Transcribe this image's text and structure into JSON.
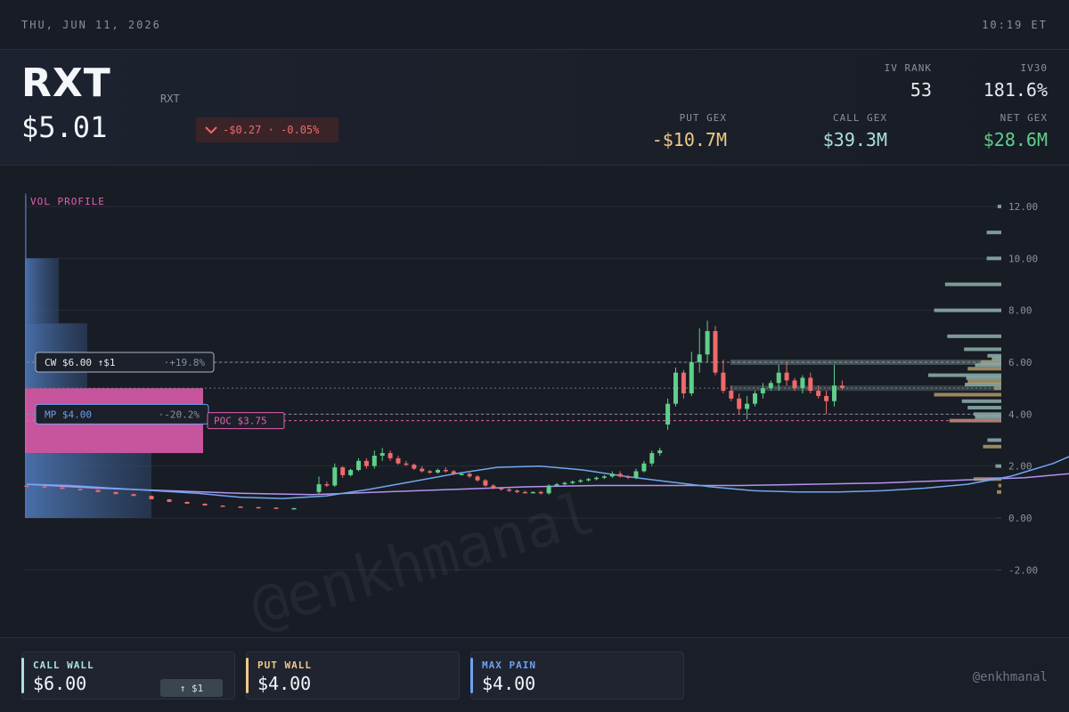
{
  "topbar": {
    "date": "THU, JUN 11, 2026",
    "time": "10:19 ET"
  },
  "quote": {
    "ticker": "RXT",
    "ticker_sub": "RXT",
    "price": "$5.01",
    "change": "-$0.27 · -0.05%"
  },
  "stats": {
    "iv_rank_label": "IV RANK",
    "iv_rank": "53",
    "iv30_label": "IV30",
    "iv30": "181.6%",
    "put_gex_label": "PUT GEX",
    "put_gex": "-$10.7M",
    "call_gex_label": "CALL GEX",
    "call_gex": "$39.3M",
    "net_gex_label": "NET GEX",
    "net_gex": "$28.6M"
  },
  "colors": {
    "up": "#5fcf8a",
    "down": "#ef6a6a",
    "put": "#f0c987",
    "call": "#a9e2dc",
    "net": "#5fcf8a",
    "maxpain": "#6fa0f0",
    "poc": "#e65fb3"
  },
  "chart_data": {
    "type": "candlestick",
    "ylim": [
      -2,
      12
    ],
    "yticks": [
      "12.00",
      "10.00",
      "8.00",
      "6.00",
      "4.00",
      "2.00",
      "0.00",
      "-2.00"
    ],
    "ytick_values": [
      12,
      10,
      8,
      6,
      4,
      2,
      0,
      -2
    ],
    "vol_profile_label": "VOL PROFILE",
    "vol_profile": [
      {
        "lo": 0,
        "hi": 2.5,
        "v": 0.71
      },
      {
        "lo": 2.5,
        "hi": 5,
        "v": 1.0,
        "poc": true
      },
      {
        "lo": 5,
        "hi": 7.5,
        "v": 0.35
      },
      {
        "lo": 7.5,
        "hi": 10,
        "v": 0.19
      },
      {
        "lo": 10,
        "hi": 12.5,
        "v": 0.01
      }
    ],
    "levels": {
      "call_wall": {
        "price": 6.0,
        "label": "CW $6.00 ↑$1",
        "pct": "·+19.8%"
      },
      "current": {
        "price": 5.0
      },
      "max_pain": {
        "price": 4.0,
        "label": "MP $4.00",
        "pct": "·-20.2%"
      },
      "poc": {
        "price": 3.75,
        "label": "POC $3.75"
      }
    },
    "ohlc": [
      [
        1.25,
        1.25,
        1.22,
        1.22
      ],
      [
        1.22,
        1.22,
        1.18,
        1.18
      ],
      [
        1.18,
        1.19,
        1.12,
        1.12
      ],
      [
        1.12,
        1.13,
        1.08,
        1.08
      ],
      [
        1.08,
        1.09,
        1.0,
        1.0
      ],
      [
        1.0,
        1.01,
        0.92,
        0.92
      ],
      [
        0.92,
        0.93,
        0.85,
        0.85
      ],
      [
        0.85,
        0.86,
        0.72,
        0.72
      ],
      [
        0.72,
        0.73,
        0.62,
        0.62
      ],
      [
        0.62,
        0.63,
        0.55,
        0.55
      ],
      [
        0.55,
        0.56,
        0.48,
        0.48
      ],
      [
        0.48,
        0.49,
        0.44,
        0.44
      ],
      [
        0.44,
        0.45,
        0.42,
        0.42
      ],
      [
        0.42,
        0.43,
        0.4,
        0.4
      ],
      [
        0.4,
        0.41,
        0.39,
        0.39
      ],
      [
        0.38,
        0.39,
        0.38,
        0.38
      ],
      [
        1.0,
        1.6,
        0.9,
        1.3
      ],
      [
        1.3,
        1.4,
        1.2,
        1.25
      ],
      [
        1.25,
        2.1,
        1.2,
        1.95
      ],
      [
        1.95,
        2.0,
        1.55,
        1.65
      ],
      [
        1.65,
        1.9,
        1.6,
        1.85
      ],
      [
        1.85,
        2.3,
        1.8,
        2.2
      ],
      [
        2.2,
        2.3,
        1.9,
        2.0
      ],
      [
        2.0,
        2.6,
        1.9,
        2.4
      ],
      [
        2.4,
        2.7,
        2.2,
        2.5
      ],
      [
        2.5,
        2.6,
        2.2,
        2.3
      ],
      [
        2.3,
        2.4,
        2.05,
        2.1
      ],
      [
        2.1,
        2.2,
        2.0,
        2.05
      ],
      [
        2.05,
        2.1,
        1.85,
        1.9
      ],
      [
        1.9,
        2.0,
        1.75,
        1.8
      ],
      [
        1.8,
        1.85,
        1.7,
        1.75
      ],
      [
        1.75,
        1.9,
        1.7,
        1.85
      ],
      [
        1.85,
        1.95,
        1.75,
        1.8
      ],
      [
        1.8,
        1.85,
        1.65,
        1.7
      ],
      [
        1.7,
        1.75,
        1.65,
        1.7
      ],
      [
        1.7,
        1.75,
        1.55,
        1.6
      ],
      [
        1.6,
        1.65,
        1.4,
        1.45
      ],
      [
        1.45,
        1.5,
        1.2,
        1.25
      ],
      [
        1.25,
        1.3,
        1.1,
        1.15
      ],
      [
        1.15,
        1.2,
        1.05,
        1.1
      ],
      [
        1.1,
        1.15,
        1.0,
        1.05
      ],
      [
        1.05,
        1.1,
        0.95,
        1.0
      ],
      [
        1.0,
        1.05,
        0.95,
        0.98
      ],
      [
        0.98,
        1.02,
        0.95,
        1.0
      ],
      [
        1.0,
        1.05,
        0.9,
        0.95
      ],
      [
        0.95,
        1.3,
        0.9,
        1.25
      ],
      [
        1.25,
        1.35,
        1.2,
        1.3
      ],
      [
        1.3,
        1.4,
        1.25,
        1.35
      ],
      [
        1.35,
        1.45,
        1.3,
        1.4
      ],
      [
        1.4,
        1.5,
        1.35,
        1.45
      ],
      [
        1.45,
        1.55,
        1.4,
        1.5
      ],
      [
        1.5,
        1.6,
        1.45,
        1.55
      ],
      [
        1.55,
        1.65,
        1.5,
        1.6
      ],
      [
        1.6,
        1.8,
        1.55,
        1.7
      ],
      [
        1.7,
        1.8,
        1.55,
        1.6
      ],
      [
        1.6,
        1.65,
        1.5,
        1.55
      ],
      [
        1.55,
        1.9,
        1.5,
        1.8
      ],
      [
        1.8,
        2.2,
        1.75,
        2.1
      ],
      [
        2.1,
        2.6,
        2.0,
        2.5
      ],
      [
        2.5,
        2.7,
        2.4,
        2.6
      ],
      [
        3.6,
        4.6,
        3.4,
        4.4
      ],
      [
        4.4,
        5.8,
        4.3,
        5.6
      ],
      [
        5.6,
        5.7,
        4.6,
        4.8
      ],
      [
        4.8,
        6.4,
        4.7,
        6.0
      ],
      [
        6.0,
        7.3,
        5.6,
        6.3
      ],
      [
        6.3,
        7.6,
        6.0,
        7.2
      ],
      [
        7.2,
        7.4,
        5.5,
        5.6
      ],
      [
        5.6,
        6.1,
        4.8,
        4.9
      ],
      [
        4.9,
        5.1,
        4.5,
        4.6
      ],
      [
        4.6,
        4.8,
        4.0,
        4.2
      ],
      [
        4.2,
        4.7,
        3.8,
        4.4
      ],
      [
        4.4,
        4.9,
        4.3,
        4.8
      ],
      [
        4.8,
        5.2,
        4.6,
        5.0
      ],
      [
        5.0,
        5.3,
        4.9,
        5.2
      ],
      [
        5.2,
        5.9,
        4.9,
        5.6
      ],
      [
        5.6,
        6.0,
        5.1,
        5.3
      ],
      [
        5.3,
        5.4,
        4.9,
        5.0
      ],
      [
        5.0,
        5.5,
        4.8,
        5.4
      ],
      [
        5.4,
        5.6,
        4.8,
        4.9
      ],
      [
        4.9,
        5.1,
        4.6,
        4.7
      ],
      [
        4.7,
        4.9,
        4.0,
        4.5
      ],
      [
        4.5,
        5.9,
        4.3,
        5.1
      ],
      [
        5.1,
        5.3,
        4.95,
        5.01
      ]
    ],
    "ma_fast": [
      [
        0,
        1.3
      ],
      [
        6,
        1.25
      ],
      [
        12,
        1.15
      ],
      [
        18,
        1.05
      ],
      [
        24,
        0.95
      ],
      [
        30,
        0.8
      ],
      [
        36,
        0.75
      ],
      [
        42,
        0.85
      ],
      [
        48,
        1.1
      ],
      [
        54,
        1.4
      ],
      [
        60,
        1.7
      ],
      [
        66,
        1.95
      ],
      [
        72,
        2.0
      ],
      [
        78,
        1.85
      ],
      [
        84,
        1.6
      ],
      [
        90,
        1.4
      ],
      [
        96,
        1.2
      ],
      [
        102,
        1.05
      ],
      [
        108,
        1.0
      ],
      [
        114,
        1.0
      ],
      [
        120,
        1.05
      ],
      [
        126,
        1.15
      ],
      [
        132,
        1.3
      ],
      [
        138,
        1.6
      ],
      [
        144,
        2.1
      ],
      [
        150,
        2.8
      ],
      [
        156,
        3.5
      ],
      [
        162,
        3.85
      ],
      [
        168,
        4.2
      ],
      [
        174,
        4.6
      ],
      [
        180,
        4.95
      ],
      [
        186,
        5.1
      ],
      [
        192,
        5.0
      ],
      [
        195,
        4.95
      ]
    ],
    "ma_slow": [
      [
        0,
        1.3
      ],
      [
        10,
        1.15
      ],
      [
        20,
        1.05
      ],
      [
        30,
        0.95
      ],
      [
        40,
        0.9
      ],
      [
        50,
        1.0
      ],
      [
        60,
        1.1
      ],
      [
        70,
        1.2
      ],
      [
        80,
        1.25
      ],
      [
        90,
        1.25
      ],
      [
        100,
        1.25
      ],
      [
        110,
        1.3
      ],
      [
        120,
        1.35
      ],
      [
        130,
        1.45
      ],
      [
        140,
        1.55
      ],
      [
        150,
        1.8
      ],
      [
        160,
        2.0
      ],
      [
        170,
        2.2
      ],
      [
        180,
        2.6
      ],
      [
        190,
        3.0
      ],
      [
        195,
        3.2
      ]
    ],
    "gex_profile": [
      {
        "price": 12.0,
        "call": 0.05
      },
      {
        "price": 11.0,
        "call": 0.2
      },
      {
        "price": 10.0,
        "call": 0.2
      },
      {
        "price": 9.0,
        "call": 0.77
      },
      {
        "price": 8.0,
        "call": 0.92
      },
      {
        "price": 7.0,
        "call": 0.74
      },
      {
        "price": 6.5,
        "call": 0.51
      },
      {
        "price": 6.25,
        "call": 0.19
      },
      {
        "price": 6.0,
        "call": 0.13,
        "put": 0.28
      },
      {
        "price": 5.75,
        "call": 0.36,
        "put": 0.46
      },
      {
        "price": 5.5,
        "call": 1.0
      },
      {
        "price": 5.25,
        "call": 0.48,
        "put": 0.46
      },
      {
        "price": 5.0,
        "call": 0.5,
        "put": 0.1
      },
      {
        "price": 4.75,
        "put": 0.92
      },
      {
        "price": 4.5,
        "call": 0.54
      },
      {
        "price": 4.25,
        "call": 0.46
      },
      {
        "price": 4.0,
        "call": 0.38
      },
      {
        "price": 3.75,
        "put": 0.71,
        "call": 0.36
      },
      {
        "price": 3.0,
        "call": 0.19
      },
      {
        "price": 2.75,
        "put": 0.25
      },
      {
        "price": 2.0,
        "call": 0.08
      },
      {
        "price": 1.5,
        "put": 0.38
      },
      {
        "price": 1.25,
        "put": 0.04
      },
      {
        "price": 1.0,
        "put": 0.06
      }
    ],
    "watermark": "@enkhmanal"
  },
  "footer": {
    "call_wall_label": "CALL WALL",
    "call_wall": "$6.00",
    "call_wall_badge": "↑ $1",
    "put_wall_label": "PUT WALL",
    "put_wall": "$4.00",
    "max_pain_label": "MAX PAIN",
    "max_pain": "$4.00",
    "handle": "@enkhmanal"
  }
}
